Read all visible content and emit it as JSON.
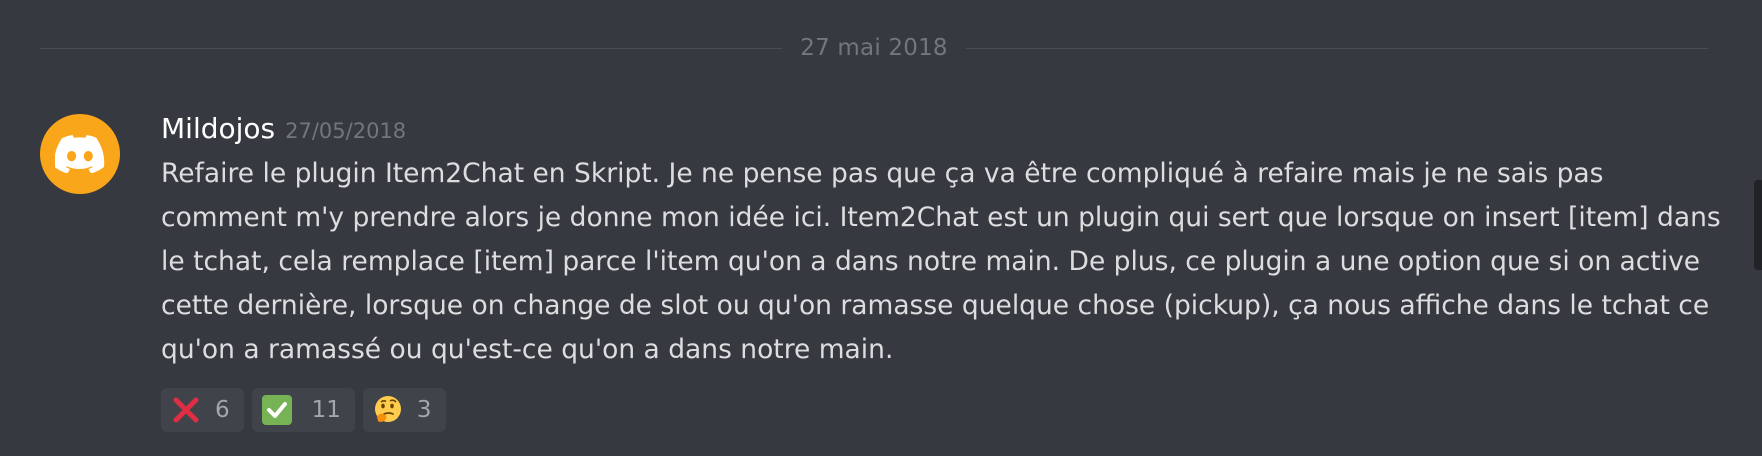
{
  "divider": {
    "date": "27 mai 2018"
  },
  "message": {
    "author": "Mildojos",
    "timestamp": "27/05/2018",
    "avatar_icon": "discord-logo-icon",
    "avatar_color": "#faa61a",
    "lines": [
      "Refaire le plugin Item2Chat en Skript. Je ne pense pas que ça va être compliqué à refaire mais je ne sais pas",
      "comment m'y prendre alors je donne mon idée ici. Item2Chat est un plugin qui sert que lorsque on insert [item] dans",
      "le tchat, cela remplace [item] parce l'item qu'on a dans notre main. De plus, ce plugin a une option que si on active",
      "cette dernière, lorsque on change de slot ou qu'on ramasse quelque chose (pickup), ça nous affiche dans le tchat ce",
      "qu'on a ramassé ou qu'est-ce qu'on a dans notre main."
    ]
  },
  "reactions": [
    {
      "emoji": "cross-mark-icon",
      "count": "6"
    },
    {
      "emoji": "check-mark-icon",
      "count": "11"
    },
    {
      "emoji": "thinking-face-icon",
      "count": "3"
    }
  ]
}
